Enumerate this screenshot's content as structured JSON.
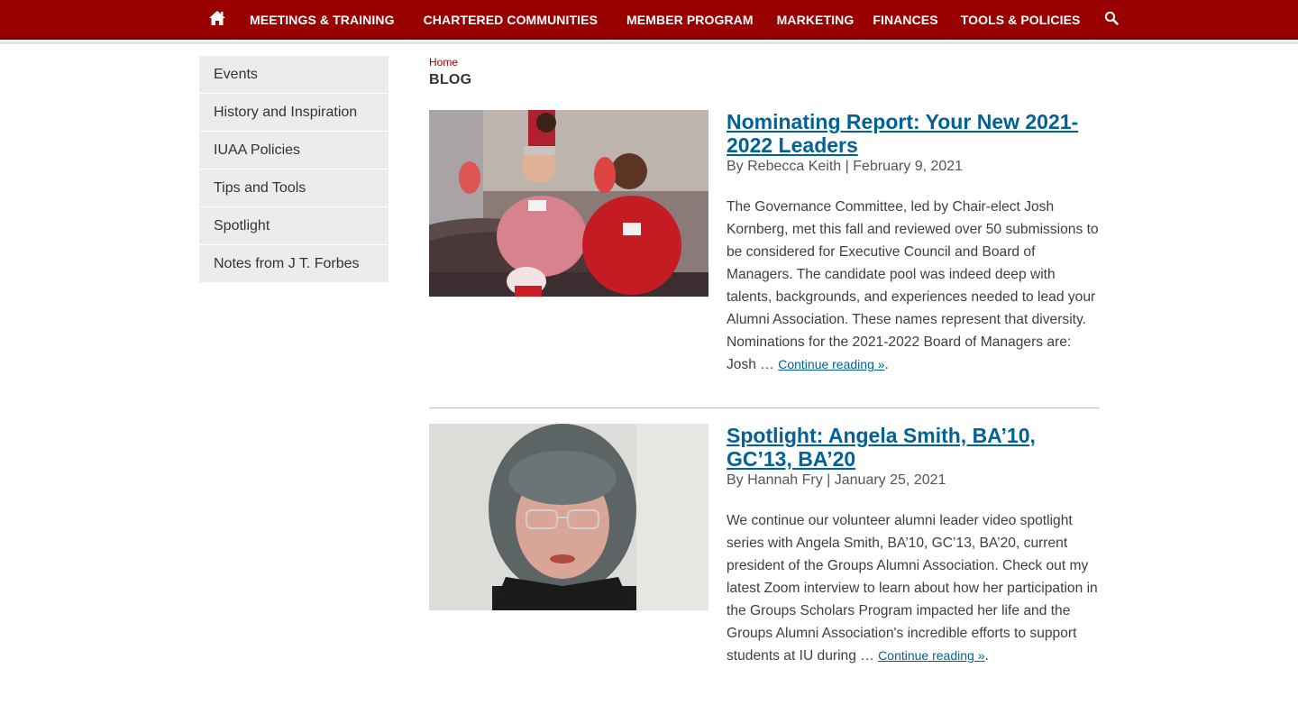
{
  "nav": {
    "home_icon": "home-icon",
    "items": [
      {
        "label": "MEETINGS & TRAINING"
      },
      {
        "label": "CHARTERED COMMUNITIES"
      },
      {
        "label": "MEMBER PROGRAM"
      },
      {
        "label": "MARKETING"
      },
      {
        "label": "FINANCES"
      },
      {
        "label": "TOOLS & POLICIES"
      }
    ],
    "search_icon": "search-icon"
  },
  "sidebar": {
    "items": [
      {
        "label": "Events"
      },
      {
        "label": "History and Inspiration"
      },
      {
        "label": "IUAA Policies"
      },
      {
        "label": "Tips and Tools"
      },
      {
        "label": "Spotlight"
      },
      {
        "label": "Notes from J T. Forbes"
      }
    ]
  },
  "breadcrumb": {
    "home": "Home"
  },
  "page": {
    "title": "BLOG"
  },
  "posts": [
    {
      "title": "Nominating Report: Your New 2021-2022 Leaders",
      "byline": "By Rebecca Keith | February 9, 2021",
      "excerpt": "The Governance Committee, led by Chair-elect Josh Kornberg, met this fall and reviewed over 50 submissions to be considered for Executive Council and Board of Managers. The candidate pool was indeed deep with talents, backgrounds, and experiences needed to lead your Alumni Association. These names represent that diversity. Nominations for the 2021-2022 Board of Managers are: Josh …",
      "more": "Continue reading »"
    },
    {
      "title": "Spotlight: Angela Smith, BA’10, GC’13, BA’20",
      "byline": "By Hannah Fry | January 25, 2021",
      "excerpt": "We continue our volunteer alumni leader video spotlight series with Angela Smith, BA’10, GC’13, BA’20, current president of the Groups Alumni Association. Check out my latest Zoom interview to learn about how her participation in the Groups Scholars Program impacted her life and the Groups Alumni Association's incredible efforts to support students at IU during …",
      "more": "Continue reading »"
    }
  ],
  "colors": {
    "brand": "#990000",
    "link": "#006298",
    "sidebar_bg": "#eeeceb"
  }
}
